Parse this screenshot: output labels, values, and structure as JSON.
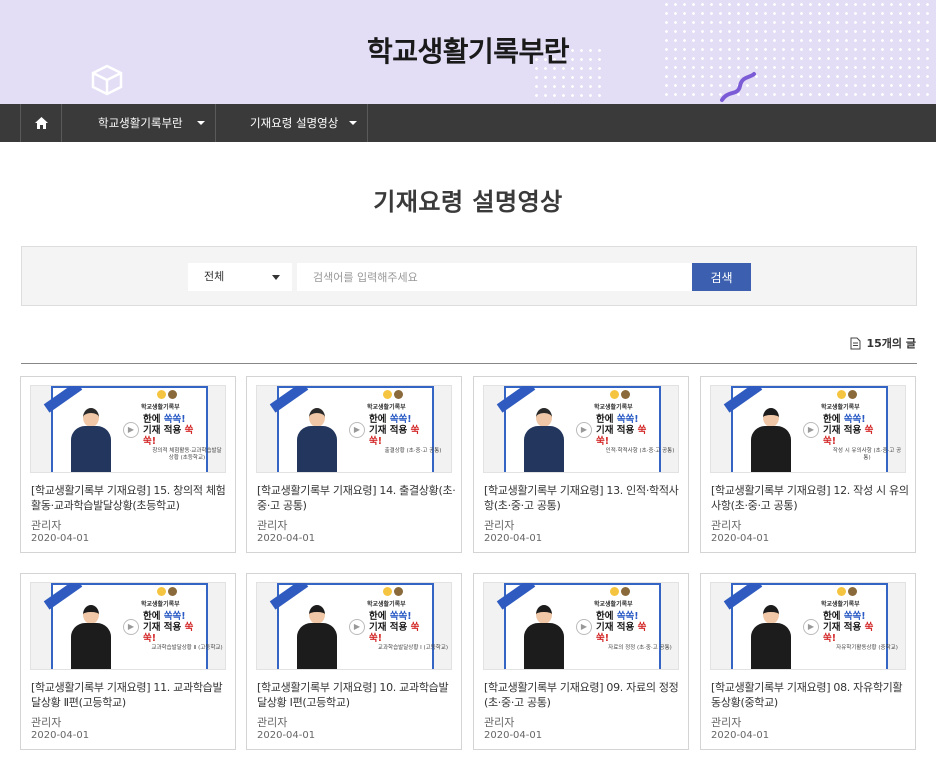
{
  "banner": {
    "title": "학교생활기록부란"
  },
  "nav": {
    "home_icon": "home-icon",
    "items": [
      {
        "label": "학교생활기록부란"
      },
      {
        "label": "기재요령 설명영상"
      }
    ]
  },
  "page": {
    "title": "기재요령 설명영상"
  },
  "search": {
    "select_value": "전체",
    "placeholder": "검색어를 입력해주세요",
    "button_label": "검색"
  },
  "count": {
    "text": "15개의 글",
    "icon": "document-icon"
  },
  "thumb_text": {
    "badge": "학교생활기록부",
    "line1_a": "한",
    "line1_b": "에 ",
    "line1_c": "쏙쏙!",
    "line2_a": "기재 적용 ",
    "line2_b": "쑥쑥!"
  },
  "posts": [
    {
      "title": "[학교생활기록부 기재요령] 15. 창의적 체험활동·교과학습발달상황(초등학교)",
      "author": "관리자",
      "date": "2020-04-01",
      "caption": "창의적 체험활동·교과학습발달상황 (초등학교)",
      "presenter": "male"
    },
    {
      "title": "[학교생활기록부 기재요령] 14. 출결상황(초·중·고 공통)",
      "author": "관리자",
      "date": "2020-04-01",
      "caption": "출결상황 (초·중·고 공통)",
      "presenter": "male"
    },
    {
      "title": "[학교생활기록부 기재요령] 13. 인적·학적사항(초·중·고 공통)",
      "author": "관리자",
      "date": "2020-04-01",
      "caption": "인적·학적사항 (초·중·고 공통)",
      "presenter": "male"
    },
    {
      "title": "[학교생활기록부 기재요령] 12. 작성 시 유의사항(초·중·고 공통)",
      "author": "관리자",
      "date": "2020-04-01",
      "caption": "작성 시 유의사항 (초·중·고 공통)",
      "presenter": "female"
    },
    {
      "title": "[학교생활기록부 기재요령] 11. 교과학습발달상황 Ⅱ편(고등학교)",
      "author": "관리자",
      "date": "2020-04-01",
      "caption": "교과학습발달상황 Ⅱ (고등학교)",
      "presenter": "female"
    },
    {
      "title": "[학교생활기록부 기재요령] 10. 교과학습발달상황 Ⅰ편(고등학교)",
      "author": "관리자",
      "date": "2020-04-01",
      "caption": "교과학습발달상황 Ⅰ (고등학교)",
      "presenter": "female"
    },
    {
      "title": "[학교생활기록부 기재요령] 09. 자료의 정정(초·중·고 공통)",
      "author": "관리자",
      "date": "2020-04-01",
      "caption": "자료의 정정 (초·중·고 공통)",
      "presenter": "female"
    },
    {
      "title": "[학교생활기록부 기재요령] 08. 자유학기활동상황(중학교)",
      "author": "관리자",
      "date": "2020-04-01",
      "caption": "자유학기활동상황 (중학교)",
      "presenter": "female"
    }
  ],
  "colors": {
    "banner_bg": "#e3def6",
    "nav_bg": "#3a3a3a",
    "accent": "#3c5fb0"
  }
}
